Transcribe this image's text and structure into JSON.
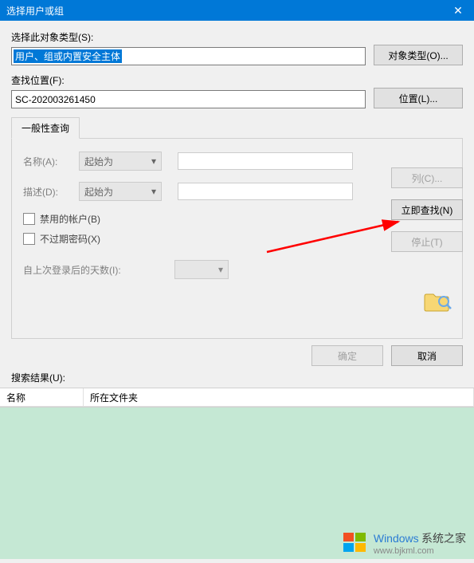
{
  "window": {
    "title": "选择用户或组"
  },
  "objectType": {
    "label": "选择此对象类型(S):",
    "value": "用户、组或内置安全主体",
    "button": "对象类型(O)..."
  },
  "location": {
    "label": "查找位置(F):",
    "value": "SC-202003261450",
    "button": "位置(L)..."
  },
  "tab": {
    "label": "一般性查询"
  },
  "query": {
    "nameLabel": "名称(A):",
    "nameMode": "起始为",
    "descLabel": "描述(D):",
    "descMode": "起始为",
    "disabledAccounts": "禁用的帐户(B)",
    "nonExpiringPwd": "不过期密码(X)",
    "daysSinceLogin": "自上次登录后的天数(I):"
  },
  "sideButtons": {
    "columns": "列(C)...",
    "searchNow": "立即查找(N)",
    "stop": "停止(T)"
  },
  "bottom": {
    "ok": "确定",
    "cancel": "取消"
  },
  "results": {
    "label": "搜索结果(U):",
    "col1": "名称",
    "col2": "所在文件夹"
  },
  "watermark": {
    "brand": "Windows",
    "site": "系统之家",
    "url": "www.bjkml.com"
  }
}
